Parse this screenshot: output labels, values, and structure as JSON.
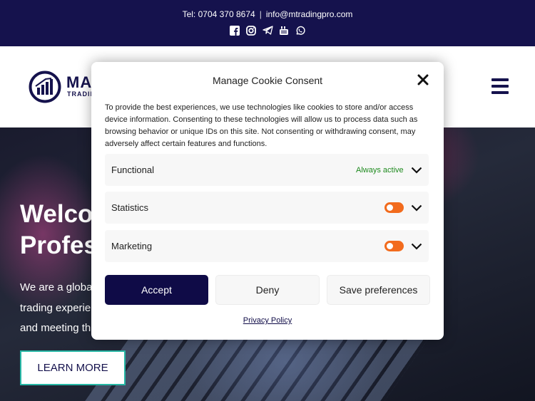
{
  "topbar": {
    "tel": "Tel: 0704 370 8674",
    "separator": "|",
    "email": "info@mtradingpro.com",
    "socials": [
      "facebook-icon",
      "instagram-icon",
      "telegram-icon",
      "youtube-icon",
      "whatsapp-icon"
    ]
  },
  "header": {
    "brand": "MA",
    "brand_sub": "TRADIN"
  },
  "hero": {
    "heading_line1": "Welco",
    "heading_line2": "Profes",
    "para_line1": "We are a globa",
    "para_line2": "trading experie",
    "para_line3": "and meeting th",
    "cta": "LEARN MORE"
  },
  "cookie": {
    "title": "Manage Cookie Consent",
    "description": "To provide the best experiences, we use technologies like cookies to store and/or access device information. Consenting to these technologies will allow us to process data such as browsing behavior or unique IDs on this site. Not consenting or withdrawing consent, may adversely affect certain features and functions.",
    "categories": [
      {
        "label": "Functional",
        "status": "Always active"
      },
      {
        "label": "Statistics"
      },
      {
        "label": "Marketing"
      }
    ],
    "accept": "Accept",
    "deny": "Deny",
    "save": "Save preferences",
    "privacy": "Privacy Policy"
  },
  "colors": {
    "navy": "#15124d",
    "accept_bg": "#0f0b47",
    "toggle": "#f26b1d",
    "always_active": "#1e8a1e",
    "cta_border": "#27b7a5"
  }
}
